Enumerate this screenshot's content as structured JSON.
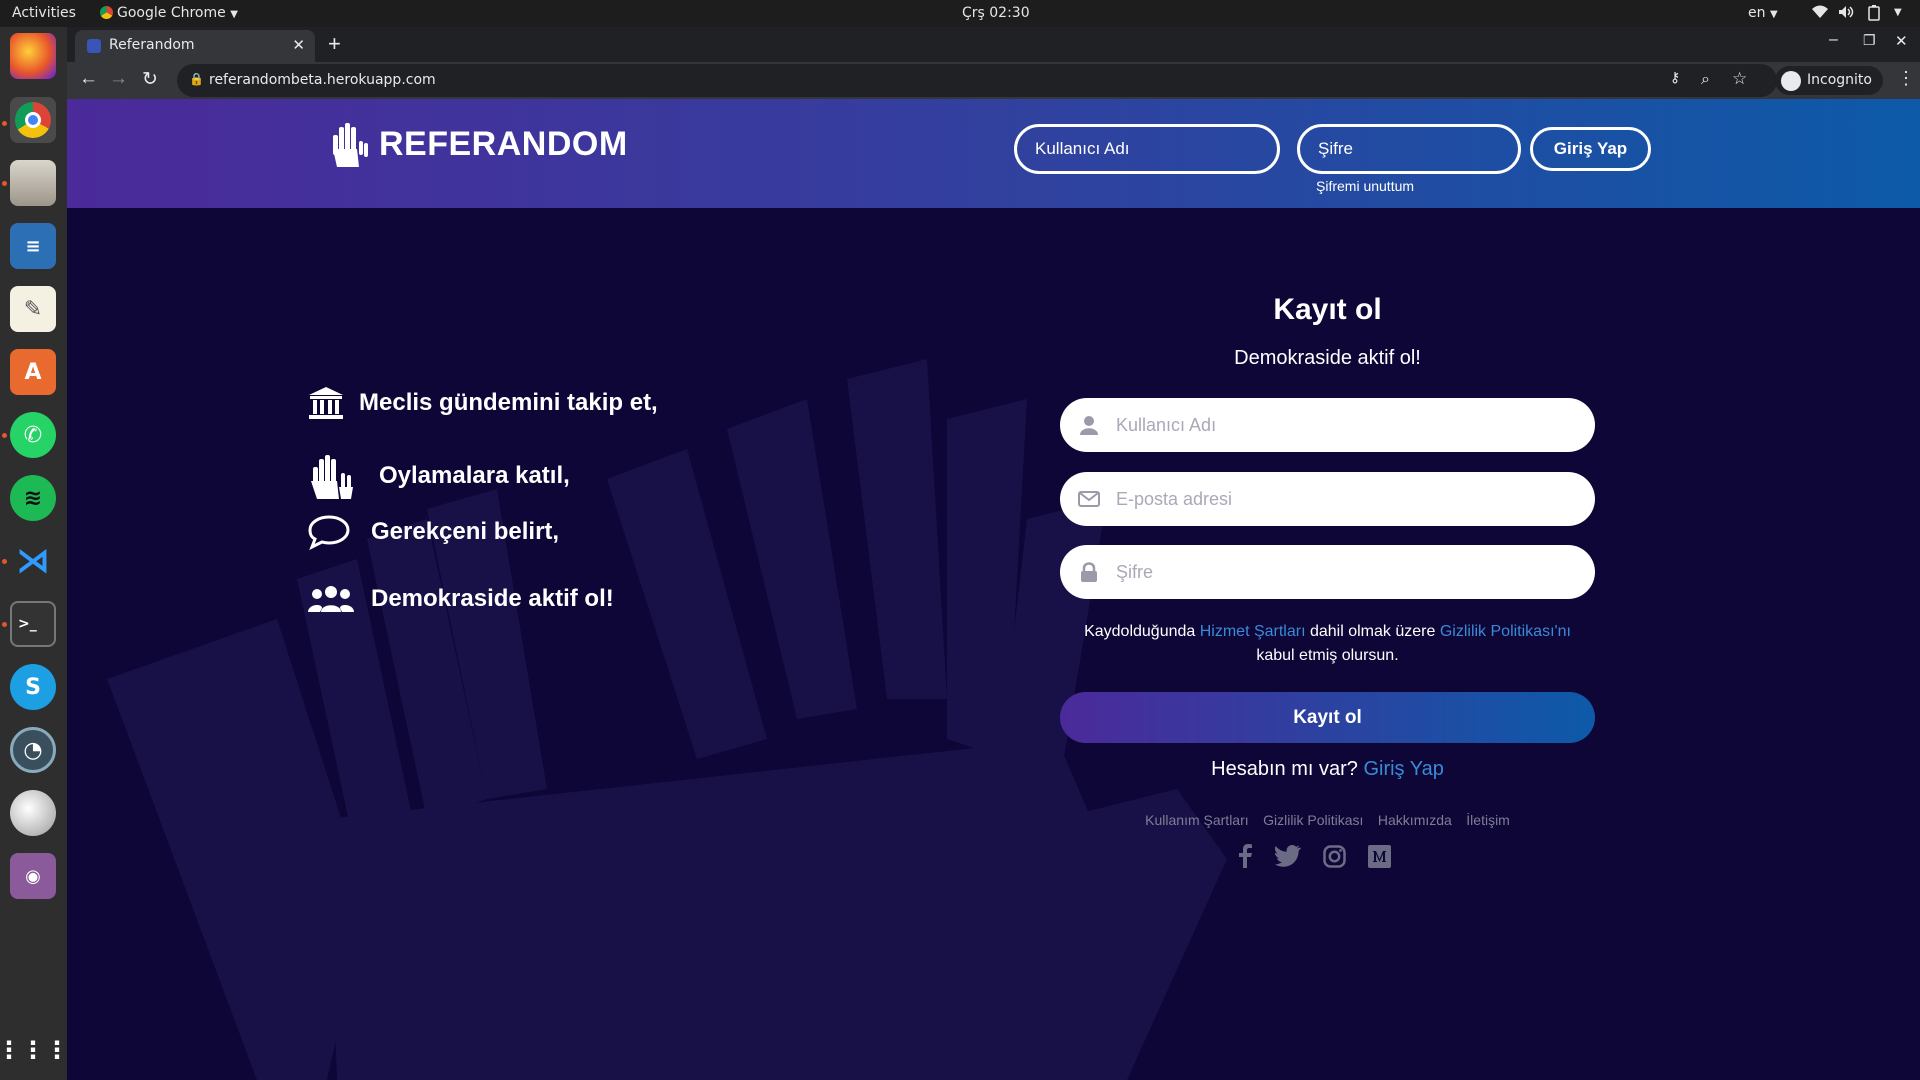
{
  "system": {
    "activities": "Activities",
    "app_name": "Google Chrome",
    "clock": "Çrş 02:30",
    "lang": "en"
  },
  "browser": {
    "tab_title": "Referandom",
    "url": "referandombeta.herokuapp.com",
    "profile": "Incognito"
  },
  "header": {
    "brand": "REFERANDOM",
    "username_placeholder": "Kullanıcı Adı",
    "password_placeholder": "Şifre",
    "login_button": "Giriş Yap",
    "forgot_link": "Şifremi unuttum"
  },
  "features": [
    {
      "icon": "parliament-icon",
      "text": "Meclis gündemini takip et,"
    },
    {
      "icon": "raised-hands-icon",
      "text": "Oylamalara katıl,"
    },
    {
      "icon": "speech-bubble-icon",
      "text": "Gerekçeni belirt,"
    },
    {
      "icon": "group-icon",
      "text": "Demokraside aktif ol!"
    }
  ],
  "signup": {
    "title": "Kayıt ol",
    "subtitle": "Demokraside aktif ol!",
    "username_placeholder": "Kullanıcı Adı",
    "email_placeholder": "E-posta adresi",
    "password_placeholder": "Şifre",
    "terms_prefix": "Kaydolduğunda ",
    "terms_link": "Hizmet Şartları",
    "terms_middle": " dahil olmak üzere ",
    "privacy_link": "Gizlilik Politikası'nı",
    "terms_suffix": " kabul etmiş olursun.",
    "submit": "Kayıt ol",
    "have_account": "Hesabın mı var? ",
    "login_link": "Giriş Yap"
  },
  "footer": {
    "links": [
      "Kullanım Şartları",
      "Gizlilik Politikası",
      "Hakkımızda",
      "İletişim"
    ],
    "social": [
      "facebook-icon",
      "twitter-icon",
      "instagram-icon",
      "medium-icon"
    ]
  },
  "colors": {
    "page_bg": "#0d0636",
    "header_start": "#4b2a9a",
    "header_end": "#0d5aa8",
    "button_start": "#4b2a9a",
    "button_end": "#0d5aa8",
    "link": "#3a8ad8"
  }
}
